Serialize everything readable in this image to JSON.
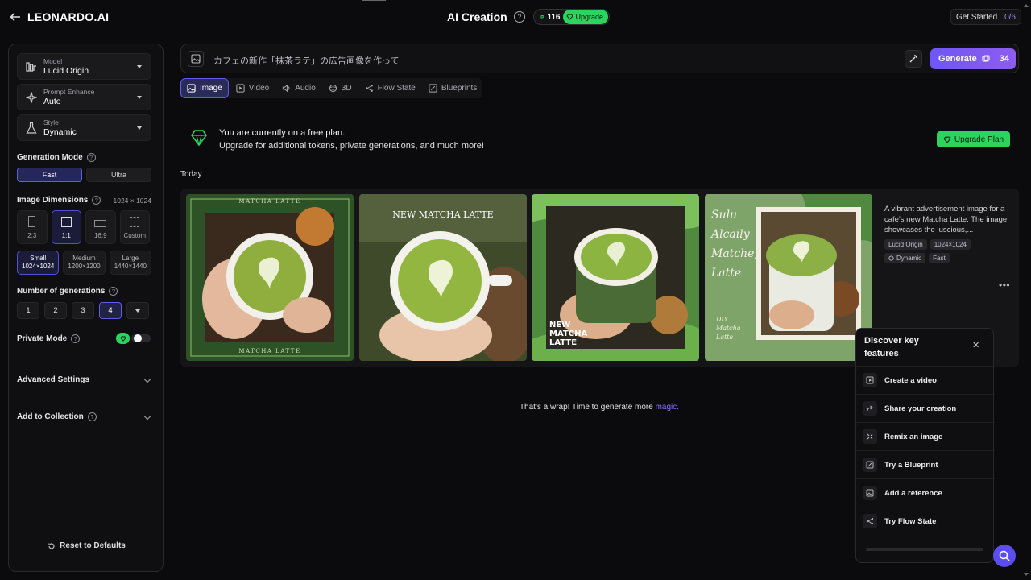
{
  "header": {
    "brand": "LEONARDO.AI",
    "title": "AI Creation",
    "tokens": "116",
    "upgrade_label": "Upgrade",
    "get_started_label": "Get Started",
    "get_started_count": "0/6"
  },
  "sidebar": {
    "model": {
      "label": "Model",
      "value": "Lucid Origin"
    },
    "prompt_enhance": {
      "label": "Prompt Enhance",
      "value": "Auto"
    },
    "style": {
      "label": "Style",
      "value": "Dynamic"
    },
    "generation_mode": {
      "label": "Generation Mode",
      "options": [
        "Fast",
        "Ultra"
      ],
      "selected": "Fast"
    },
    "image_dimensions": {
      "label": "Image Dimensions",
      "value": "1024 × 1024",
      "ratios": [
        "2:3",
        "1:1",
        "16:9",
        "Custom"
      ],
      "selected_ratio": "1:1",
      "sizes": [
        {
          "name": "Small",
          "dims": "1024×1024"
        },
        {
          "name": "Medium",
          "dims": "1200×1200"
        },
        {
          "name": "Large",
          "dims": "1440×1440"
        }
      ],
      "selected_size": "Small"
    },
    "num_generations": {
      "label": "Number of generations",
      "options": [
        "1",
        "2",
        "3",
        "4"
      ],
      "selected": "4"
    },
    "private_mode": {
      "label": "Private Mode",
      "enabled": false
    },
    "advanced_settings_label": "Advanced Settings",
    "add_to_collection_label": "Add to Collection",
    "reset_label": "Reset to Defaults"
  },
  "prompt": {
    "text": "カフェの新作「抹茶ラテ」の広告画像を作って",
    "generate_label": "Generate",
    "generate_cost": "34"
  },
  "media_tabs": [
    "Image",
    "Video",
    "Audio",
    "3D",
    "Flow State",
    "Blueprints"
  ],
  "media_tab_selected": "Image",
  "plan_banner": {
    "line1": "You are currently on a free plan.",
    "line2": "Upgrade for additional tokens, private generations, and much more!",
    "button": "Upgrade Plan"
  },
  "feed": {
    "section": "Today",
    "images": [
      {
        "top_text": "MATCHA LATTE",
        "bottom_text": "MATCHA LATTE"
      },
      {
        "top_text": "NEW MATCHA LATTE"
      },
      {
        "bottom_text": "NEW MATCHA LATTE"
      },
      {
        "script_text": "Sulu Alcaily Matche, Latte",
        "side_text": "DIY Matcha Latte"
      }
    ],
    "description": "A vibrant advertisement image for a cafe's new Matcha Latte. The image showcases the luscious,...",
    "chips": [
      "Lucid Origin",
      "1024×1024",
      "Dynamic",
      "Fast"
    ]
  },
  "footer_message": {
    "text": "That's a wrap! Time to generate more ",
    "link": "magic."
  },
  "discover": {
    "title": "Discover key features",
    "items": [
      "Create a video",
      "Share your creation",
      "Remix an image",
      "Try a Blueprint",
      "Add a reference",
      "Try Flow State"
    ]
  },
  "colors": {
    "accent": "#6f57f5",
    "green": "#2bd45c",
    "background": "#0b0b0d"
  }
}
